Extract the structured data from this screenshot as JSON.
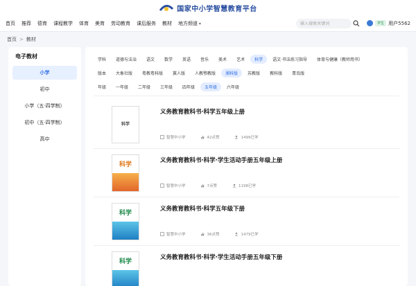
{
  "header": {
    "site_title": "国家中小学智慧教育平台"
  },
  "nav": {
    "items": [
      "首页",
      "推荐",
      "德育",
      "课程教学",
      "体育",
      "美育",
      "劳动教育",
      "课后服务",
      "教材",
      "地方频道"
    ],
    "search_placeholder": "输入搜索关键词",
    "user_badge": "学生",
    "user_name": "用户5562"
  },
  "breadcrumb": {
    "home": "首页",
    "current": "教材"
  },
  "sidebar": {
    "title": "电子教材",
    "items": [
      "小学",
      "初中",
      "小学（五·四学制）",
      "初中（五·四学制）",
      "高中"
    ],
    "active_index": 0
  },
  "filters": {
    "subjects": [
      "学科",
      "道德与法治",
      "语文",
      "数学",
      "英语",
      "音乐",
      "美术",
      "艺术",
      "科学",
      "语文·书法练习指导",
      "体育与健康（教师用书）"
    ],
    "versions": [
      "版本",
      "大象社版",
      "粤教粤科版",
      "冀人版",
      "人教鄂教版",
      "湘科版",
      "苏教版",
      "教科版",
      "青岛版"
    ],
    "grades": [
      "年级",
      "一年级",
      "二年级",
      "三年级",
      "四年级",
      "五年级",
      "六年级"
    ],
    "active_subject": "科学",
    "active_version": "湘科版",
    "active_grade": "五年级"
  },
  "books": [
    {
      "title": "义务教育教科书·科学五年级上册",
      "source": "智慧中小学",
      "likes": "42点赞",
      "learners": "1499已学",
      "cover_style": "plain",
      "cover_label": "科学"
    },
    {
      "title": "义务教育教科书·科学·学生活动手册五年级上册",
      "source": "智慧中小学",
      "likes": "7点赞",
      "learners": "1198已学",
      "cover_style": "orange",
      "cover_label": "科学"
    },
    {
      "title": "义务教育教科书·科学五年级下册",
      "source": "智慧中小学",
      "likes": "36点赞",
      "learners": "1479已学",
      "cover_style": "blue",
      "cover_label": "科学"
    },
    {
      "title": "义务教育教科书·科学·学生活动手册五年级下册",
      "source": "",
      "likes": "",
      "learners": "",
      "cover_style": "blue",
      "cover_label": "科学"
    }
  ],
  "colors": {
    "accent": "#2f6fe4",
    "active_bg": "#e4edff",
    "brand": "#2a4fa0"
  }
}
